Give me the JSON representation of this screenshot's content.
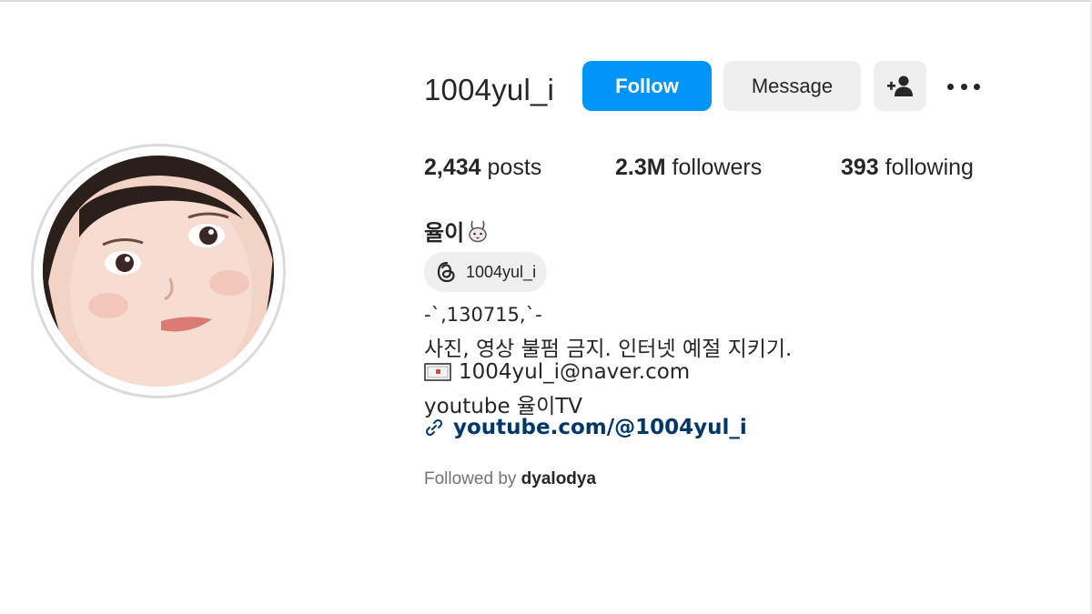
{
  "profile": {
    "username": "1004yul_i",
    "avatar_icon": "profile-photo",
    "actions": {
      "follow_label": "Follow",
      "message_label": "Message",
      "suggest_icon": "add-person-icon",
      "more_icon": "more-options-icon"
    },
    "stats": {
      "posts_count": "2,434",
      "posts_label": "posts",
      "followers_count": "2.3M",
      "followers_label": "followers",
      "following_count": "393",
      "following_label": "following"
    },
    "full_name": "율이",
    "full_name_icon": "bunny-icon",
    "threads": {
      "icon": "threads-icon",
      "handle": "1004yul_i"
    },
    "bio": {
      "line1": "-`,130715,`-",
      "line2": "사진, 영상 불펌 금지. 인터넷 예절 지키기.",
      "line3_icon": "mail-icon",
      "line3": "1004yul_i@naver.com",
      "line4": "youtube 율이TV"
    },
    "link": {
      "icon": "link-icon",
      "text": "youtube.com/@1004yul_i"
    },
    "followed_by": {
      "prefix": "Followed by",
      "user": "dyalodya"
    }
  },
  "colors": {
    "follow_blue": "#0095f6",
    "button_gray": "#efefef",
    "link_navy": "#00376b",
    "muted_text": "#737373"
  }
}
